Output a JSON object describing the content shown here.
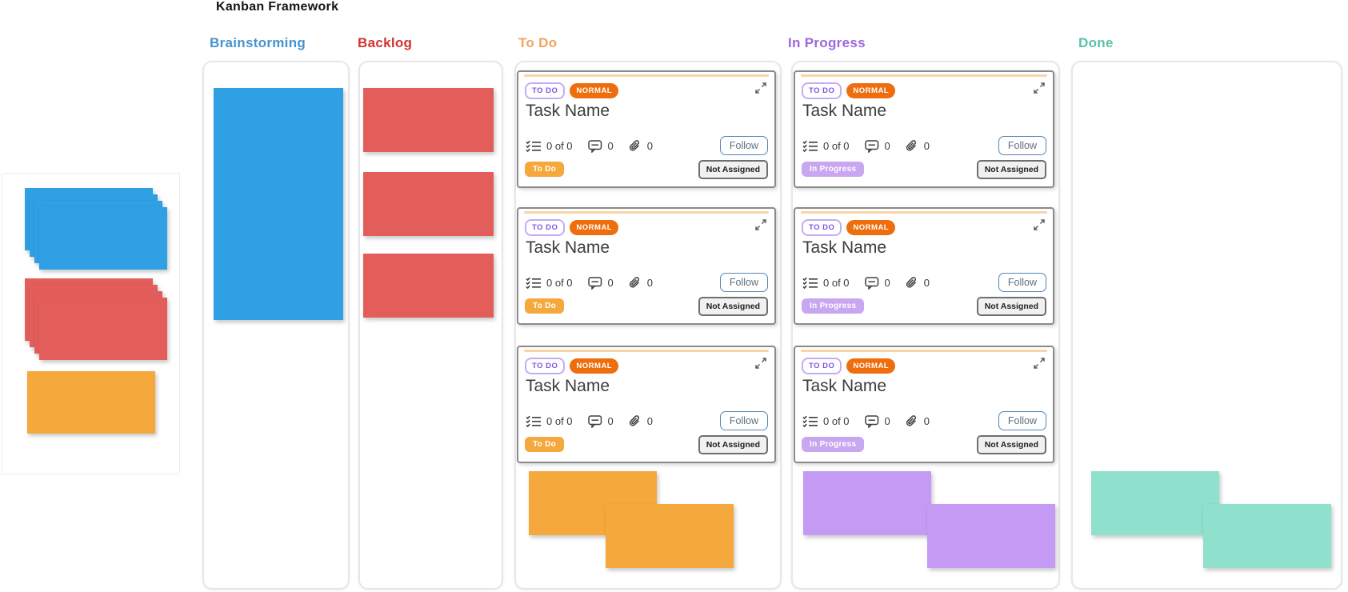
{
  "board": {
    "title": "Kanban Framework"
  },
  "columns": [
    {
      "id": "brainstorming",
      "label": "Brainstorming",
      "label_color": "#4493CE",
      "sticky_color": "#2FA0E4"
    },
    {
      "id": "backlog",
      "label": "Backlog",
      "label_color": "#D3322F",
      "sticky_color": "#E35D5B"
    },
    {
      "id": "todo",
      "label": "To Do",
      "label_color": "#F2A45C",
      "sticky_color": "#F5A83C"
    },
    {
      "id": "in-progress",
      "label": "In Progress",
      "label_color": "#9D66DD",
      "sticky_color": "#C49AF5"
    },
    {
      "id": "done",
      "label": "Done",
      "label_color": "#57C3A7",
      "sticky_color": "#8FE0CD"
    }
  ],
  "palette_stacks": [
    {
      "name": "blue-sticky-stack",
      "color": "#2FA0E4",
      "count": 4
    },
    {
      "name": "red-sticky-stack",
      "color": "#E35D5B",
      "count": 4
    },
    {
      "name": "orange-sticky-note",
      "color": "#F5A83C",
      "count": 1
    }
  ],
  "card_colors": {
    "status_border": "#C4ACF2",
    "status_text": "#7D55E2",
    "priority_bg": "#EE6D0D",
    "accent_line": "#F9D4A6",
    "todo_tag_bg": "#F5A83C",
    "inprogress_tag_bg": "#C9A6F0"
  },
  "cards": [
    {
      "status_label": "TO DO",
      "priority_label": "NORMAL",
      "title": "Task Name",
      "checklist_count": "0 of 0",
      "comment_count": "0",
      "attachment_count": "0",
      "follow_label": "Follow",
      "tag_label": "To Do",
      "assignee_label": "Not Assigned"
    },
    {
      "status_label": "TO DO",
      "priority_label": "NORMAL",
      "title": "Task Name",
      "checklist_count": "0 of 0",
      "comment_count": "0",
      "attachment_count": "0",
      "follow_label": "Follow",
      "tag_label": "To Do",
      "assignee_label": "Not Assigned"
    },
    {
      "status_label": "TO DO",
      "priority_label": "NORMAL",
      "title": "Task Name",
      "checklist_count": "0 of 0",
      "comment_count": "0",
      "attachment_count": "0",
      "follow_label": "Follow",
      "tag_label": "To Do",
      "assignee_label": "Not Assigned"
    },
    {
      "status_label": "TO DO",
      "priority_label": "NORMAL",
      "title": "Task Name",
      "checklist_count": "0 of 0",
      "comment_count": "0",
      "attachment_count": "0",
      "follow_label": "Follow",
      "tag_label": "In Progress",
      "assignee_label": "Not Assigned"
    },
    {
      "status_label": "TO DO",
      "priority_label": "NORMAL",
      "title": "Task Name",
      "checklist_count": "0 of 0",
      "comment_count": "0",
      "attachment_count": "0",
      "follow_label": "Follow",
      "tag_label": "In Progress",
      "assignee_label": "Not Assigned"
    },
    {
      "status_label": "TO DO",
      "priority_label": "NORMAL",
      "title": "Task Name",
      "checklist_count": "0 of 0",
      "comment_count": "0",
      "attachment_count": "0",
      "follow_label": "Follow",
      "tag_label": "In Progress",
      "assignee_label": "Not Assigned"
    }
  ]
}
